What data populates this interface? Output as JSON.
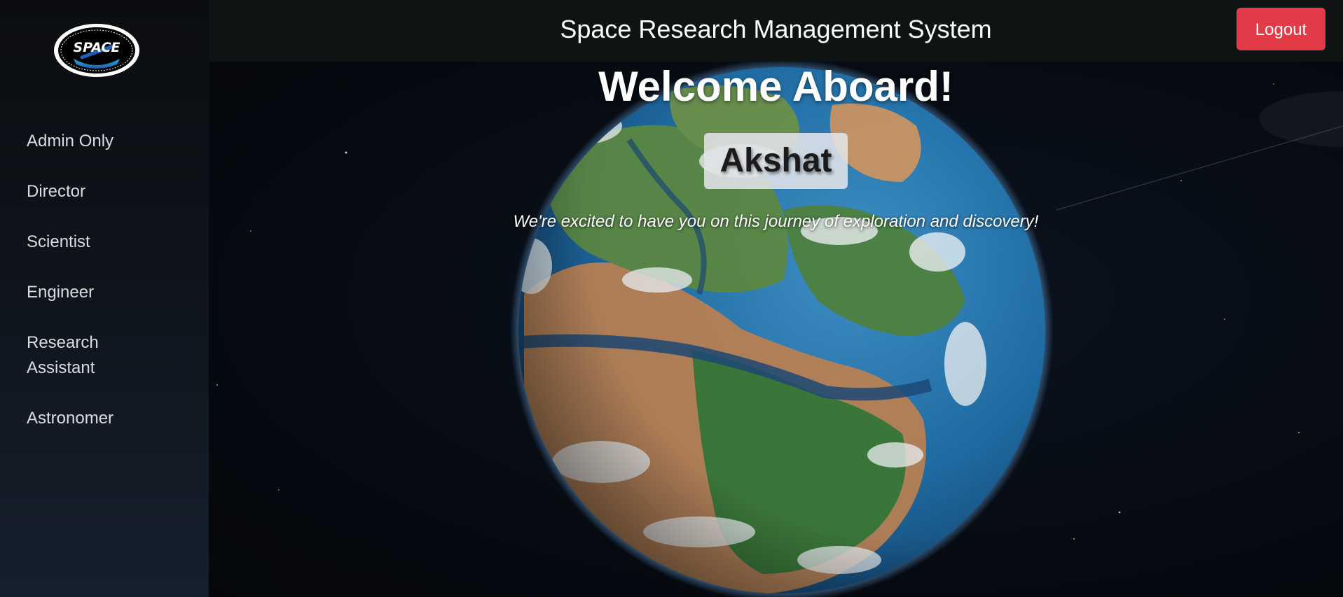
{
  "window": {
    "title": "Space Research Management System"
  },
  "header": {
    "title": "Space Research Management System",
    "logout_label": "Logout",
    "logout_color": "#e23b47"
  },
  "sidebar": {
    "logo": {
      "icon": "space-logo-icon",
      "text": "SPACE"
    },
    "items": [
      {
        "label": "Admin Only"
      },
      {
        "label": "Director"
      },
      {
        "label": "Scientist"
      },
      {
        "label": "Engineer"
      },
      {
        "label": "Research Assistant"
      },
      {
        "label": "Astronomer"
      }
    ]
  },
  "main": {
    "welcome": "Welcome Aboard!",
    "user_name": "Akshat",
    "tagline": "We're excited to have you on this journey of exploration and discovery!",
    "background": "planet-earth-image"
  },
  "colors": {
    "sidebar_bg": "#0b0d10",
    "topbar_bg": "#0f1614",
    "ocean": "#1f6fa8",
    "land_green": "#3c7a3c",
    "land_tan": "#b5835a"
  }
}
